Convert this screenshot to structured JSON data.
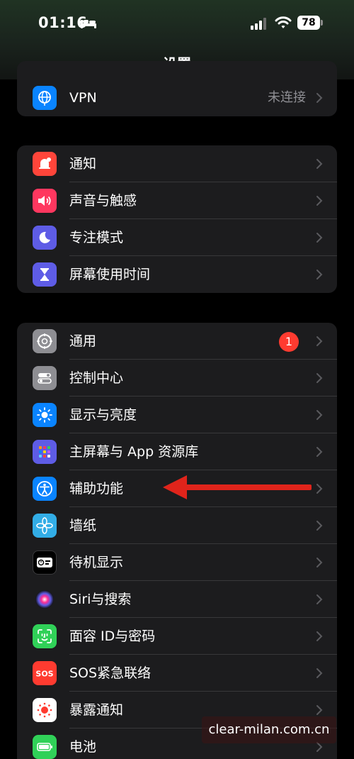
{
  "status": {
    "time": "01:16",
    "battery": "78"
  },
  "title": "设置",
  "groups": [
    {
      "rows": [
        {
          "label": "VPN",
          "value": "未连接",
          "icon": "globe-icon",
          "color": "#0a84ff"
        }
      ]
    },
    {
      "rows": [
        {
          "label": "通知",
          "icon": "bell-icon",
          "color": "#ff453a"
        },
        {
          "label": "声音与触感",
          "icon": "speaker-icon",
          "color": "#ff375f"
        },
        {
          "label": "专注模式",
          "icon": "moon-icon",
          "color": "#5e5ce6"
        },
        {
          "label": "屏幕使用时间",
          "icon": "hourglass-icon",
          "color": "#5e5ce6"
        }
      ]
    },
    {
      "rows": [
        {
          "label": "通用",
          "badge": "1",
          "icon": "gear-icon",
          "color": "#8e8e93"
        },
        {
          "label": "控制中心",
          "icon": "toggles-icon",
          "color": "#8e8e93"
        },
        {
          "label": "显示与亮度",
          "icon": "sun-icon",
          "color": "#0a84ff"
        },
        {
          "label": "主屏幕与 App 资源库",
          "icon": "app-grid-icon",
          "color": "#5e5ce6"
        },
        {
          "label": "辅助功能",
          "icon": "accessibility-icon",
          "color": "#0a84ff"
        },
        {
          "label": "墙纸",
          "icon": "flower-icon",
          "color": "#32ade6"
        },
        {
          "label": "待机显示",
          "icon": "standby-icon",
          "color": "#000000"
        },
        {
          "label": "Siri与搜索",
          "icon": "siri-icon",
          "color": "#2c2c2e"
        },
        {
          "label": "面容 ID与密码",
          "icon": "face-id-icon",
          "color": "#30d158"
        },
        {
          "label": "SOS紧急联络",
          "icon": "sos-icon",
          "color": "#ff3b30"
        },
        {
          "label": "暴露通知",
          "icon": "exposure-icon",
          "color": "#ffffff"
        },
        {
          "label": "电池",
          "icon": "battery-icon",
          "color": "#30d158"
        }
      ]
    }
  ],
  "watermark": "clear-milan.com.cn"
}
